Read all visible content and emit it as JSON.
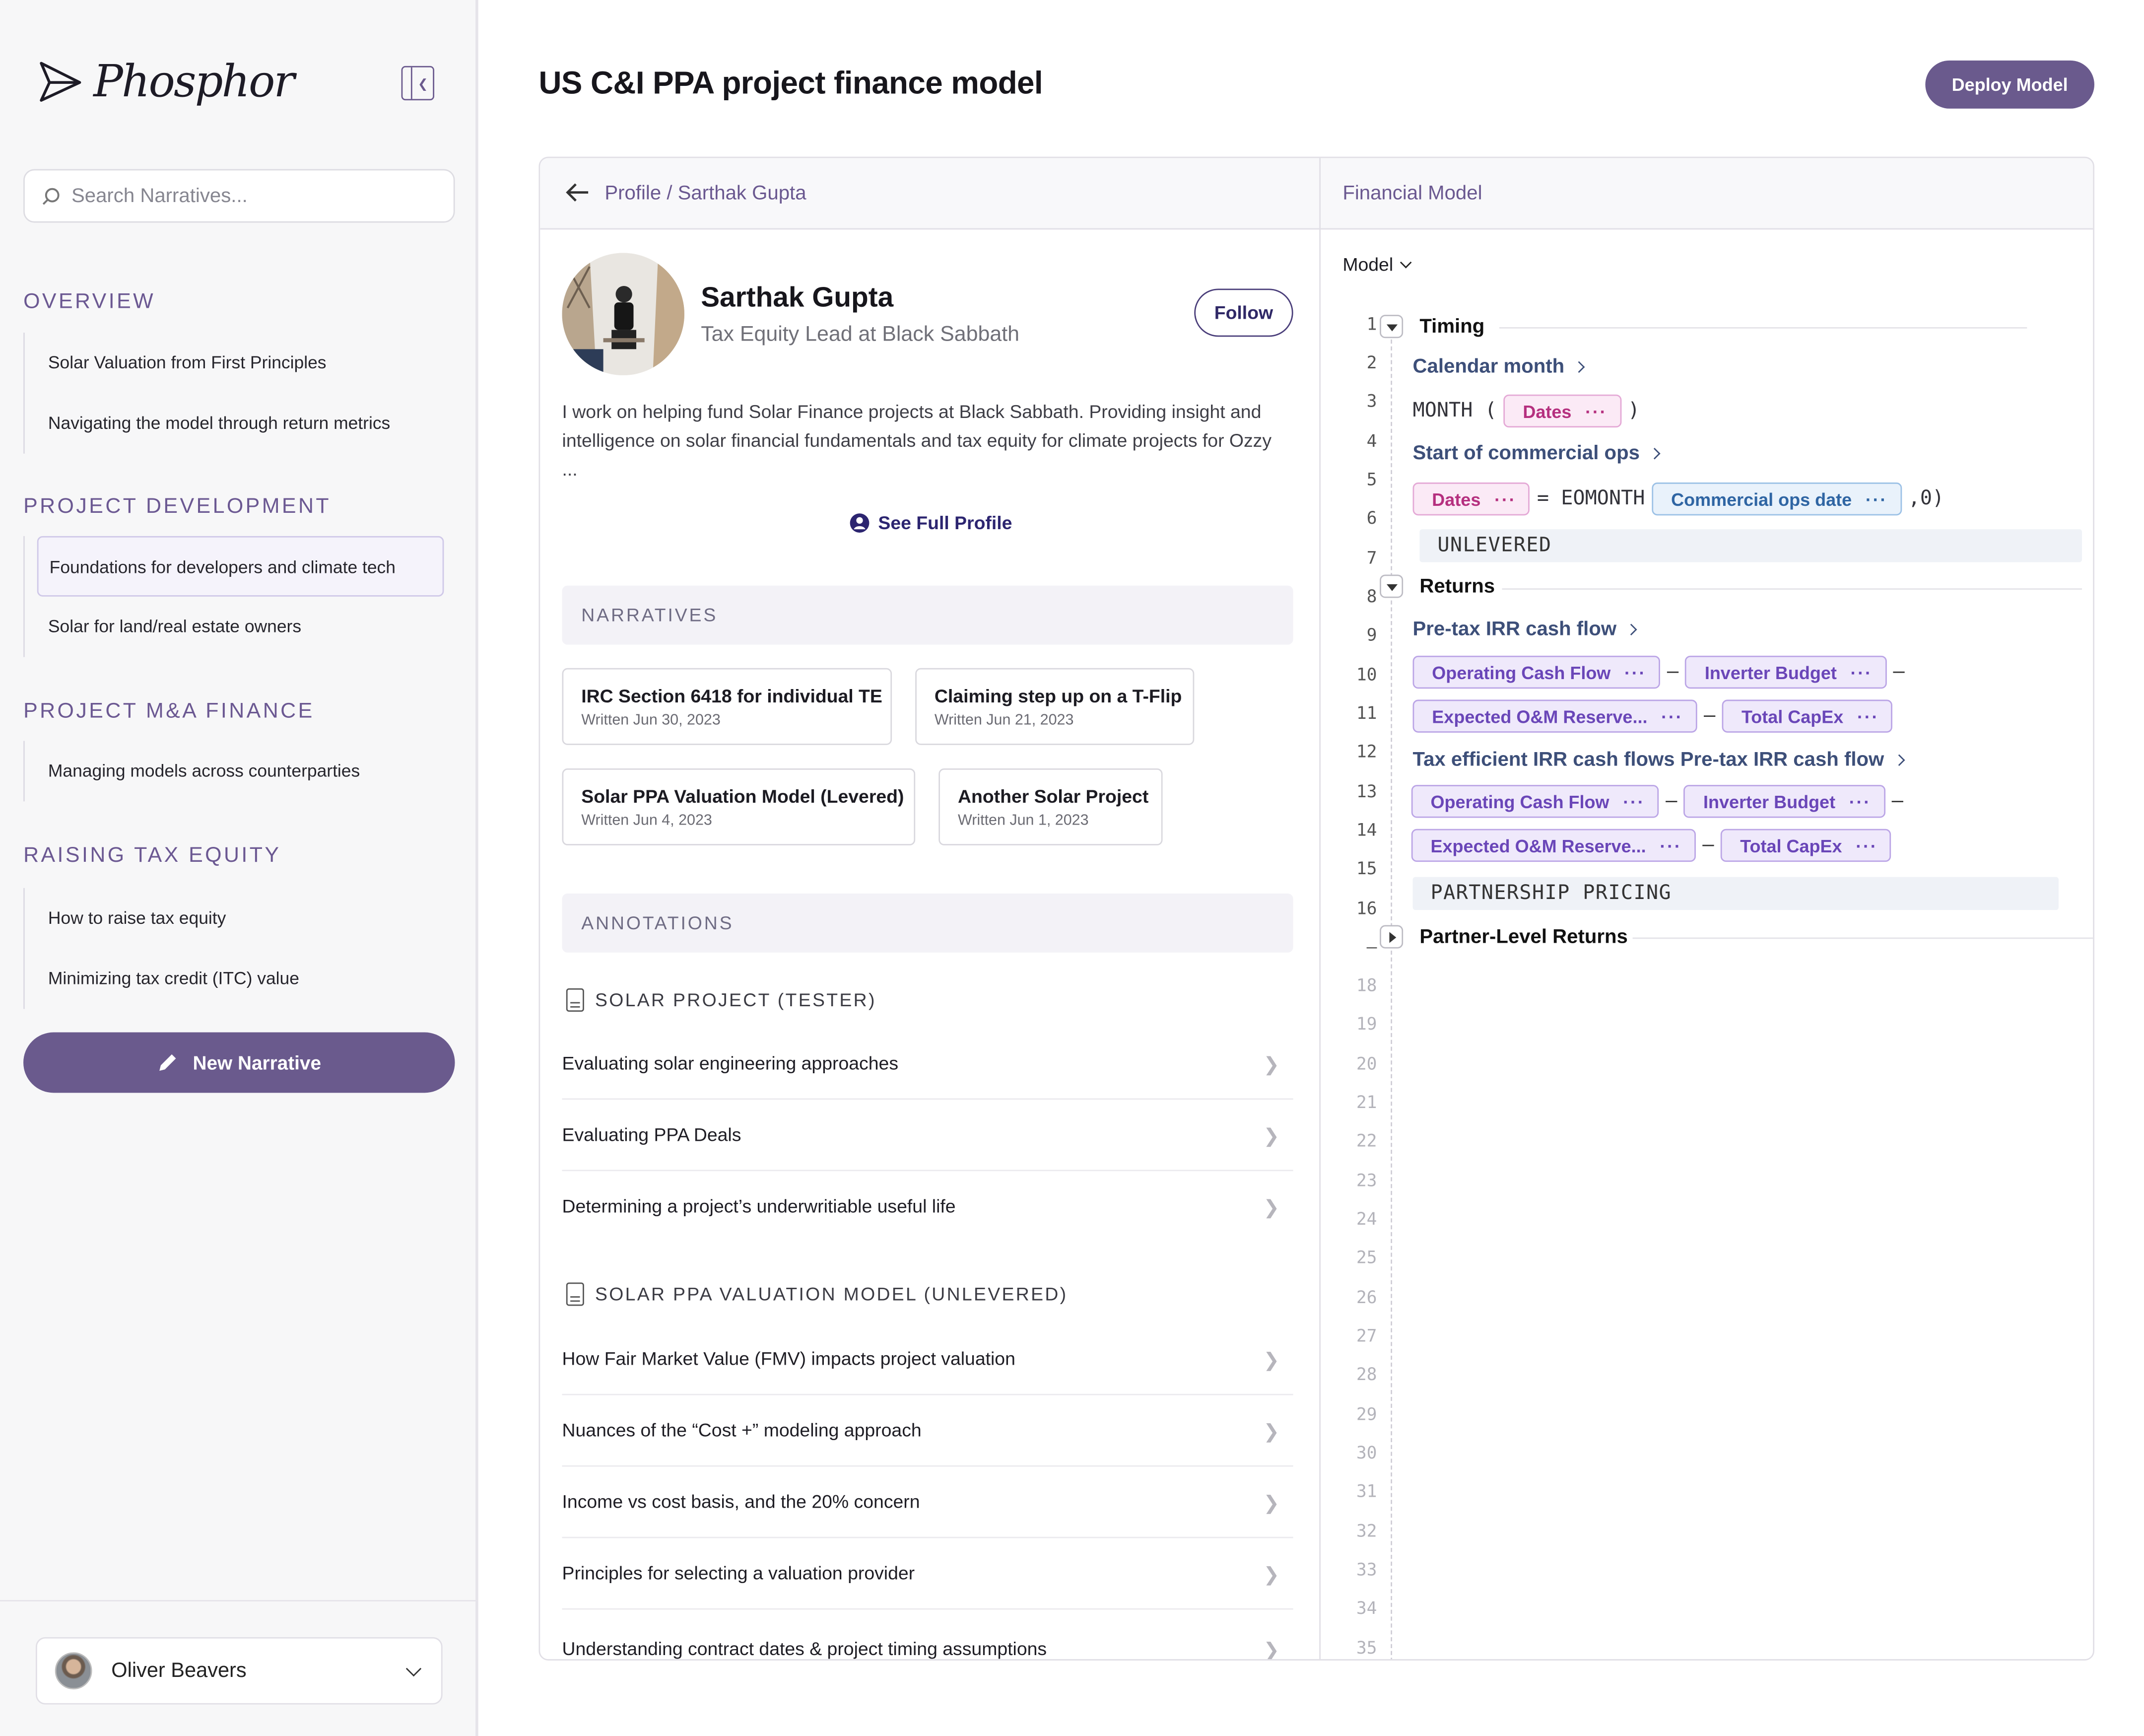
{
  "app": {
    "name": "Phosphor",
    "collapse_icon": "sidebar-collapse-icon"
  },
  "search": {
    "placeholder": "Search Narratives..."
  },
  "sidebar": {
    "sections": [
      {
        "title": "OVERVIEW",
        "items": [
          "Solar Valuation from First Principles",
          "Navigating the model through return metrics"
        ]
      },
      {
        "title": "PROJECT DEVELOPMENT",
        "items": [
          "Foundations for developers and climate tech",
          "Solar for land/real estate owners"
        ],
        "active_index": 0
      },
      {
        "title": "PROJECT M&A FINANCE",
        "items": [
          "Managing models across counterparties"
        ]
      },
      {
        "title": "RAISING TAX EQUITY",
        "items": [
          "How to raise tax equity",
          "Minimizing tax credit  (ITC) value"
        ]
      }
    ],
    "new_narrative": "New Narrative",
    "user": "Oliver Beavers"
  },
  "header": {
    "title": "US C&I PPA project finance model",
    "deploy": "Deploy Model"
  },
  "profile": {
    "breadcrumb": "Profile / Sarthak Gupta",
    "name": "Sarthak Gupta",
    "role": "Tax Equity Lead at Black Sabbath",
    "follow": "Follow",
    "bio": "I work on helping fund Solar Finance projects at Black Sabbath. Providing insight and intelligence on solar financial fundamentals and tax equity for climate projects for Ozzy ...",
    "see_full": "See Full Profile",
    "narratives_label": "NARRATIVES",
    "narratives": [
      {
        "title": "IRC Section 6418 for individual TE",
        "date": "Written Jun 30, 2023"
      },
      {
        "title": "Claiming step up on a T-Flip",
        "date": "Written Jun 21, 2023"
      },
      {
        "title": "Solar PPA Valuation Model (Levered)",
        "date": "Written Jun 4, 2023"
      },
      {
        "title": "Another Solar Project",
        "date": "Written Jun 1, 2023"
      }
    ],
    "annotations_label": "ANNOTATIONS",
    "annotation_groups": [
      {
        "title": "SOLAR PROJECT (TESTER)",
        "items": [
          "Evaluating solar engineering approaches",
          "Evaluating PPA Deals",
          "Determining a project’s underwritiable useful life"
        ]
      },
      {
        "title": "SOLAR PPA VALUATION MODEL (UNLEVERED)",
        "items": [
          "How Fair Market Value (FMV) impacts project valuation",
          "Nuances of the “Cost +” modeling approach",
          "Income vs cost basis, and the 20% concern",
          "Principles for selecting a valuation provider",
          "Understanding contract dates & project timing assumptions"
        ]
      }
    ]
  },
  "model": {
    "panel_title": "Financial Model",
    "selector": "Model",
    "line_numbers": [
      "1",
      "2",
      "3",
      "4",
      "5",
      "6",
      "7",
      "8",
      "9",
      "10",
      "11",
      "12",
      "13",
      "14",
      "15",
      "16",
      "–",
      "18",
      "19",
      "20",
      "21",
      "22",
      "23",
      "24",
      "25",
      "26",
      "27",
      "28",
      "29",
      "30",
      "31",
      "32",
      "33",
      "34",
      "35"
    ],
    "timing": "Timing",
    "calendar_month": "Calendar month",
    "month_fn": "MONTH (",
    "close_paren": ")",
    "dates": "Dates",
    "start_cod": "Start of commercial ops",
    "eq_eomonth": "= EOMONTH",
    "commercial_ops_date": "Commercial ops date",
    "trail": ",0)",
    "unlevered": "UNLEVERED",
    "returns": "Returns",
    "pretax_irr": "Pre-tax IRR cash flow",
    "operating_cash_flow": "Operating Cash Flow",
    "inverter_budget": "Inverter Budget",
    "expected_om": "Expected O&M Reserve...",
    "total_capex": "Total CapEx",
    "minus": "–",
    "tax_efficient": "Tax efficient IRR cash flows Pre-tax IRR cash flow",
    "partnership_pricing": "PARTNERSHIP PRICING",
    "partner_returns": "Partner-Level Returns",
    "dots": "···"
  }
}
